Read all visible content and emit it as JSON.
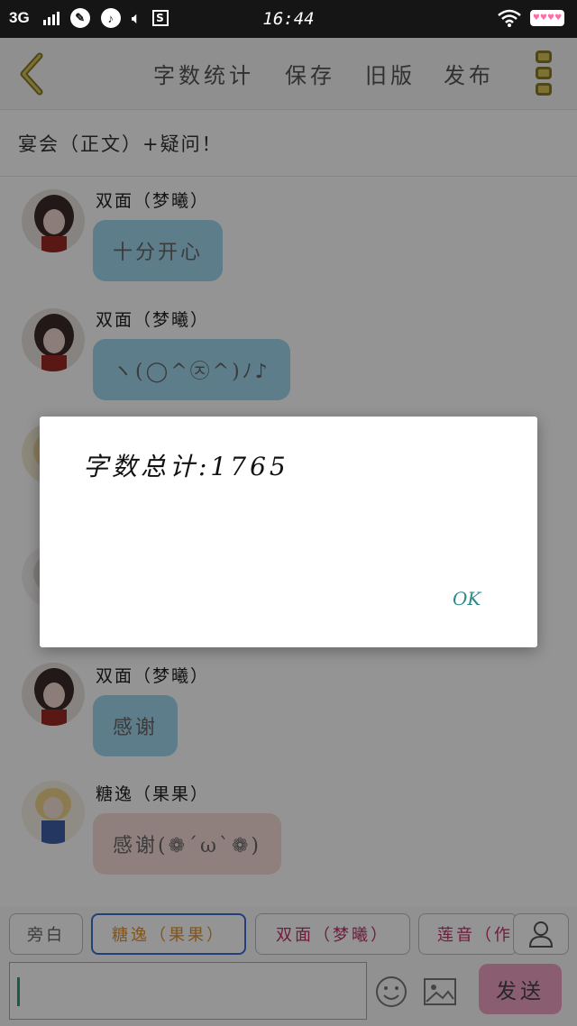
{
  "status_bar": {
    "network": "3G",
    "time": "16:44",
    "icons": [
      "signal-icon",
      "paint-icon",
      "music-icon",
      "speaker-icon",
      "s-icon",
      "wifi-icon",
      "battery-icon"
    ]
  },
  "header": {
    "nav": [
      "字数统计",
      "保存",
      "旧版",
      "发布"
    ]
  },
  "story_title": "宴会（正文）+疑问！",
  "messages": [
    {
      "speaker": "双面（梦曦）",
      "text": "十分开心",
      "color": "blue"
    },
    {
      "speaker": "双面（梦曦）",
      "text": "ヽ(◯^㉨^)ﾉ♪",
      "color": "blue"
    },
    {
      "speaker": "双面（梦曦）",
      "text": "感谢",
      "color": "blue"
    },
    {
      "speaker": "糖逸（果果）",
      "text": "感谢(❁´ω`❁)",
      "color": "pink"
    }
  ],
  "roles": [
    {
      "label": "旁白",
      "color": "#666666"
    },
    {
      "label": "糖逸（果果）",
      "color": "#e0922c"
    },
    {
      "label": "双面（梦曦）",
      "color": "#c0306a"
    },
    {
      "label": "莲音（作",
      "color": "#c0306a"
    }
  ],
  "input": {
    "placeholder": ""
  },
  "send_label": "发送",
  "dialog": {
    "message": "字数总计:1765",
    "ok_label": "OK"
  },
  "colors": {
    "accent_olive": "#8b7a2b",
    "bubble_blue": "#a3d7ee",
    "bubble_pink": "#f6dcda",
    "send_pink": "#f0a0c2",
    "selected_border": "#3b6fd8"
  }
}
